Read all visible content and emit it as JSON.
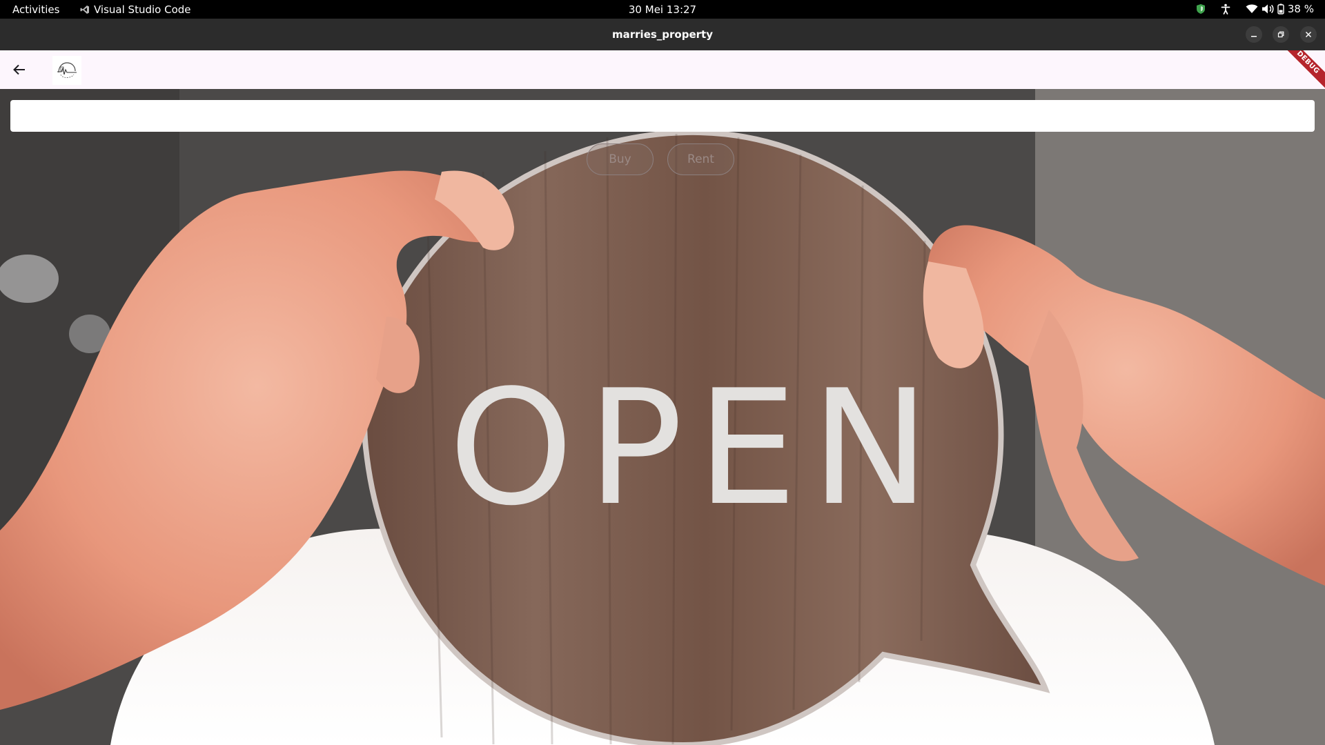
{
  "topbar": {
    "activities": "Activities",
    "app_name": "Visual Studio Code",
    "clock": "30 Mei  13:27",
    "battery": "38 %"
  },
  "window": {
    "title": "marries_property"
  },
  "app": {
    "debug_banner": "DEBUG",
    "search": {
      "placeholder": "",
      "value": ""
    },
    "chips": [
      {
        "label": "Buy"
      },
      {
        "label": "Rent"
      }
    ],
    "hero_sign_text": "OPEN"
  },
  "colors": {
    "appbar_bg": "#fdf6fd",
    "debug_ribbon": "#b5242b",
    "sign_wood": "#7a5b4e"
  },
  "icons": {
    "back": "arrow-left",
    "logo": "brand-logo",
    "close": "close",
    "maximize": "maximize",
    "minimize": "minimize"
  }
}
